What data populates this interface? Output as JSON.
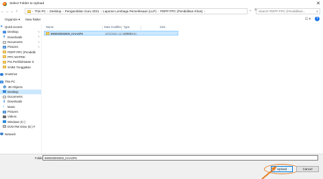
{
  "window": {
    "title": "Select Folder to Upload",
    "close": "✕"
  },
  "nav_buttons": {
    "back": "←",
    "forward": "→",
    "recent": "⌄",
    "up": "↑"
  },
  "address": {
    "crumbs": [
      "This PC",
      "Desktop",
      "Pengambilan Guru 2021",
      "Laporan Lembaga Pemeriksaan (LLP)",
      "PDPP PPC (Pendidikan Khas)"
    ],
    "separator": "›",
    "dropdown": "⌄",
    "refresh": "↻"
  },
  "search": {
    "placeholder": "Search PDPP PPC (Pendidikan..."
  },
  "toolbar": {
    "organize_label": "Organize ▾",
    "new_folder_label": "New folder",
    "view_icon": "☷ ▾",
    "help_icon": "?"
  },
  "navigation": {
    "quick_access": [
      {
        "label": "Quick access",
        "icon": "star-icon",
        "pinned": false
      },
      {
        "label": "Desktop",
        "icon": "desktop-icon",
        "pinned": true
      },
      {
        "label": "Downloads",
        "icon": "download-icon",
        "pinned": true
      },
      {
        "label": "Documents",
        "icon": "documents-icon",
        "pinned": true
      },
      {
        "label": "Pictures",
        "icon": "pictures-icon",
        "pinned": true
      },
      {
        "label": "PDPP PPC (Pendidik",
        "icon": "folder-icon",
        "pinned": false
      },
      {
        "label": "PPC MATRIK",
        "icon": "folder-icon",
        "pinned": false
      },
      {
        "label": "Pra Perkhidmatan S",
        "icon": "folder-icon",
        "pinned": false
      },
      {
        "label": "SABK Tunggakan",
        "icon": "folder-icon",
        "pinned": false
      }
    ],
    "onedrive": "OneDrive",
    "this_pc": [
      {
        "label": "This PC",
        "icon": "computer-icon"
      },
      {
        "label": "3D Objects",
        "icon": "3d-objects-icon"
      },
      {
        "label": "Desktop",
        "icon": "desktop-icon",
        "selected": true
      },
      {
        "label": "Documents",
        "icon": "documents-icon"
      },
      {
        "label": "Downloads",
        "icon": "download-icon"
      },
      {
        "label": "Music",
        "icon": "music-icon"
      },
      {
        "label": "Pictures",
        "icon": "pictures-icon"
      },
      {
        "label": "Videos",
        "icon": "videos-icon"
      },
      {
        "label": "Windows (C:)",
        "icon": "drive-icon"
      },
      {
        "label": "DVD RW Drive (E:) F",
        "icon": "dvd-drive-icon"
      }
    ],
    "network": "Network"
  },
  "list": {
    "columns": {
      "name": "Name",
      "date_modified": "Date modified",
      "type": "Type",
      "size": "Size"
    },
    "rows": [
      {
        "name": "990000000000_KHASPK",
        "date_modified": "10/1/2021 12:21 PM",
        "type": "File folder",
        "size": ""
      }
    ]
  },
  "bottom": {
    "folder_label": "Folder:",
    "folder_value": "990000000000_KHASPK",
    "upload_label": "Upload",
    "cancel_label": "Cancel"
  },
  "colors": {
    "selection": "#cce8ff",
    "accent": "#0078d7",
    "highlight_annotation": "#e67e22",
    "folder": "#f7d675"
  }
}
